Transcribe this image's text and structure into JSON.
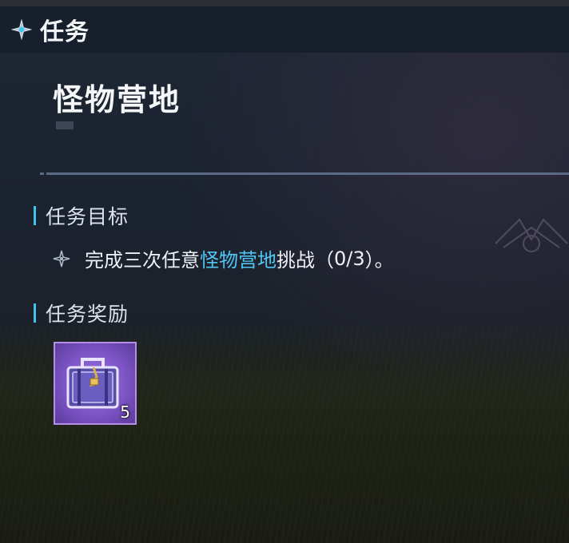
{
  "header": {
    "title": "任务",
    "icon": "compass-star-icon"
  },
  "quest": {
    "name": "怪物营地"
  },
  "objective_section": {
    "label": "任务目标"
  },
  "objective": {
    "icon": "diamond-star-icon",
    "text_before": "完成三次任意",
    "text_highlight": "怪物营地",
    "text_after": "挑战（",
    "progress": "0/3",
    "text_end": "）。"
  },
  "reward_section": {
    "label": "任务奖励"
  },
  "rewards": [
    {
      "icon": "treasure-chest-icon",
      "count": "5",
      "rarity_color": "#8a5fd4"
    }
  ],
  "colors": {
    "accent": "#3fc3f0",
    "highlight": "#4fc6f3",
    "reward_frame": "#b58fe6"
  }
}
